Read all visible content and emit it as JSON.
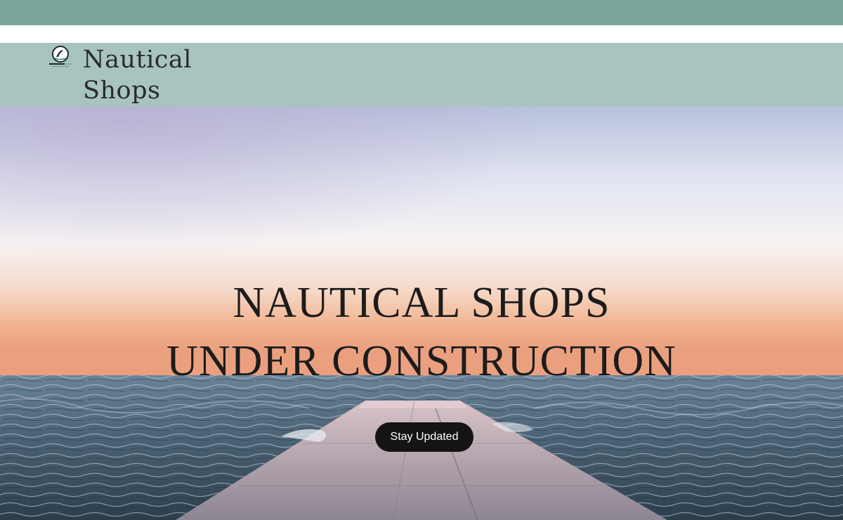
{
  "header": {
    "site_name": "Nautical\nShops",
    "logo_icon": "nautical-shops-logo-icon"
  },
  "hero": {
    "headline_line1": "NAUTICAL SHOPS",
    "headline_line2": "UNDER CONSTRUCTION",
    "cta_label": "Stay Updated"
  },
  "colors": {
    "top_strip": "#7ba69d",
    "header_bg": "#a8c4be",
    "cta_bg": "#141414",
    "cta_text": "#ffffff",
    "headline_text": "#1c1c1c"
  }
}
